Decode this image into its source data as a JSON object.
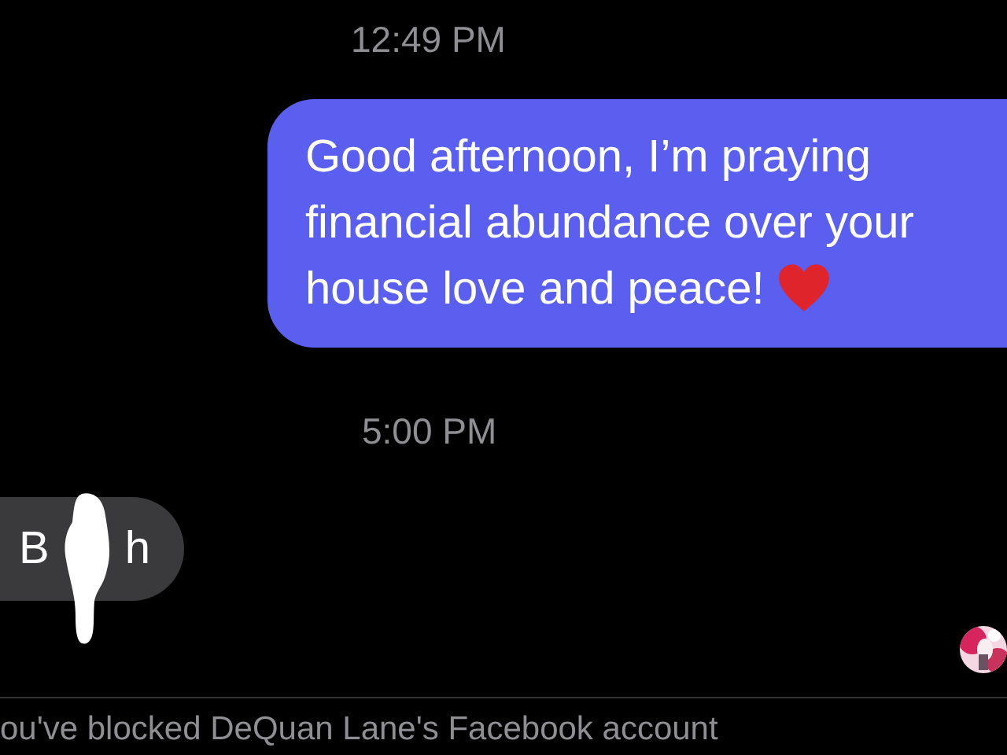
{
  "messages": [
    {
      "kind": "timestamp",
      "text": "12:49 PM"
    },
    {
      "kind": "outgoing",
      "text": "Good afternoon, I’m praying financial abundance over your house love and peace!",
      "heart": true
    },
    {
      "kind": "timestamp",
      "text": "5:00 PM"
    },
    {
      "kind": "incoming",
      "parts": [
        "B",
        "h"
      ],
      "redacted": true
    }
  ],
  "notice": "ou've blocked DeQuan Lane's Facebook account"
}
